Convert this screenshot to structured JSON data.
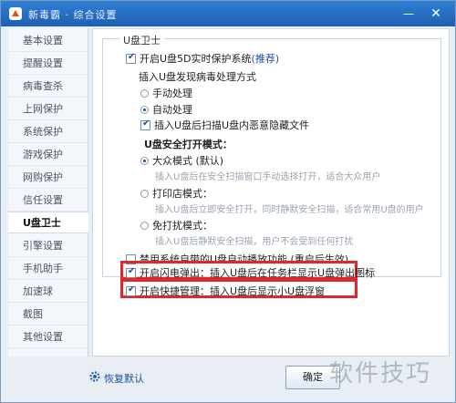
{
  "window": {
    "title": "新毒霸 · 综合设置"
  },
  "sidebar": {
    "items": [
      {
        "label": "基本设置"
      },
      {
        "label": "提醒设置"
      },
      {
        "label": "病毒查杀"
      },
      {
        "label": "上网保护"
      },
      {
        "label": "系统保护"
      },
      {
        "label": "游戏保护"
      },
      {
        "label": "网购保护"
      },
      {
        "label": "信任设置"
      },
      {
        "label": "U盘卫士"
      },
      {
        "label": "引擎设置"
      },
      {
        "label": "手机助手"
      },
      {
        "label": "加速球"
      },
      {
        "label": "截图"
      },
      {
        "label": "其他设置"
      }
    ],
    "active_index": 8
  },
  "group": {
    "title": "U盘卫士"
  },
  "options": {
    "realtime": {
      "label": "开启U盘5D实时保护系统",
      "suffix": "(推荐)",
      "checked": true
    },
    "on_insert_label": "插入U盘发现病毒处理方式",
    "manual": {
      "label": "手动处理",
      "selected": false
    },
    "auto": {
      "label": "自动处理",
      "selected": true
    },
    "scan_hidden": {
      "label": "插入U盘后扫描U盘内恶意隐藏文件",
      "checked": true
    },
    "safe_open_label": "U盘安全打开模式：",
    "mass": {
      "label": "大众模式 (默认)",
      "desc": "插入U盘后在安全扫描窗口手动选择打开，适合大众用户",
      "selected": true
    },
    "print": {
      "label": "打印店模式：",
      "desc": "插入U盘后立即安全打开，同时静默安全扫描，适合常用U盘的用户",
      "selected": false
    },
    "no_disturb": {
      "label": "免打扰模式：",
      "desc": "插入U盘后静默安全扫描，用户不会受到任何打扰",
      "selected": false
    }
  },
  "autoplay": {
    "label": "禁用系统自带的U盘自动播放功能 (重启后生效)",
    "checked": false
  },
  "flash_popup": {
    "label": "开启闪电弹出：插入U盘后在任务栏显示U盘弹出图标",
    "checked": true
  },
  "quick_manage": {
    "label": "开启快捷管理：插入U盘后显示小U盘浮窗",
    "checked": true
  },
  "footer": {
    "restore_label": "恢复默认",
    "ok_label": "确定"
  },
  "watermark": {
    "text": "软件技巧"
  },
  "colors": {
    "titlebar": "#2f7fd3",
    "highlight": "#e3262c",
    "link": "#1b4fa0"
  }
}
